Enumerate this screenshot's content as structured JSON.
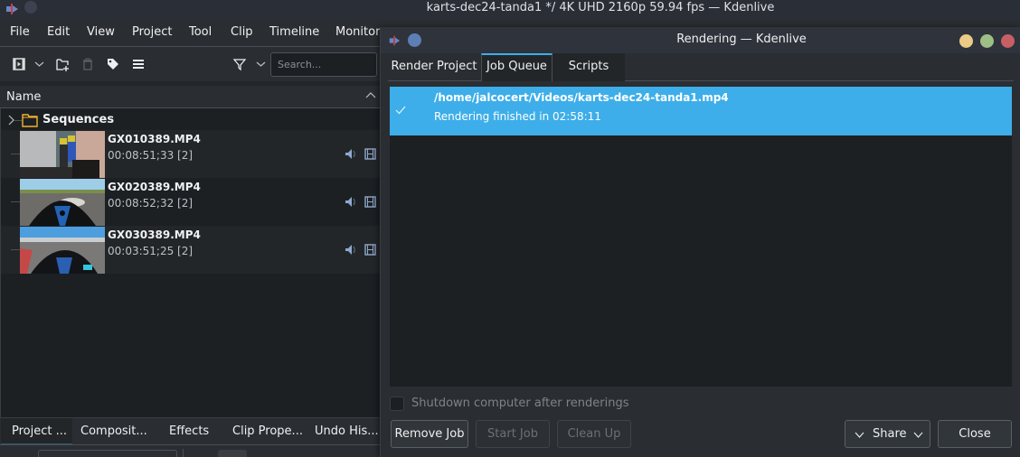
{
  "main_window": {
    "title": "karts-dec24-tanda1 */ 4K UHD 2160p 59.94 fps — Kdenlive"
  },
  "menubar": {
    "items": [
      "File",
      "Edit",
      "View",
      "Project",
      "Tool",
      "Clip",
      "Timeline",
      "Monitor"
    ]
  },
  "bin_toolbar": {
    "icons": [
      "add-clip-icon",
      "chevron-down-icon",
      "add-folder-icon",
      "delete-icon",
      "tag-icon",
      "menu-icon",
      "filter-icon",
      "chevron-down-icon"
    ],
    "search_placeholder": "Search..."
  },
  "bin": {
    "column_header": "Name",
    "folder": {
      "label": "Sequences",
      "icon": "folder-icon"
    },
    "clips": [
      {
        "name": "GX010389.MP4",
        "duration": "00:08:51;33 [2]"
      },
      {
        "name": "GX020389.MP4",
        "duration": "00:08:52;32 [2]"
      },
      {
        "name": "GX030389.MP4",
        "duration": "00:03:51;25 [2]"
      }
    ]
  },
  "bottom_tabs": {
    "items": [
      "Project ...",
      "Composit...",
      "Effects",
      "Clip Prope...",
      "Undo His..."
    ],
    "active": 0
  },
  "dialog": {
    "title": "Rendering — Kdenlive",
    "tabs": [
      "Render Project",
      "Job Queue",
      "Scripts"
    ],
    "active_tab": 1,
    "jobs": [
      {
        "path": "/home/jalcocert/Videos/karts-dec24-tanda1.mp4",
        "status": "Rendering finished in 02:58:11",
        "state_icon": "checkmark-icon"
      }
    ],
    "shutdown_label": "Shutdown computer after renderings",
    "shutdown_checked": false,
    "buttons": {
      "remove_job": "Remove Job",
      "start_job": "Start Job",
      "clean_up": "Clean Up",
      "share": "Share",
      "close": "Close"
    }
  },
  "colors": {
    "accent": "#3daee9",
    "background": "#232629",
    "folder": "#f0b232",
    "win_minimize": "#eccb86",
    "win_maximize": "#9dbf86",
    "win_close": "#c85f64"
  }
}
